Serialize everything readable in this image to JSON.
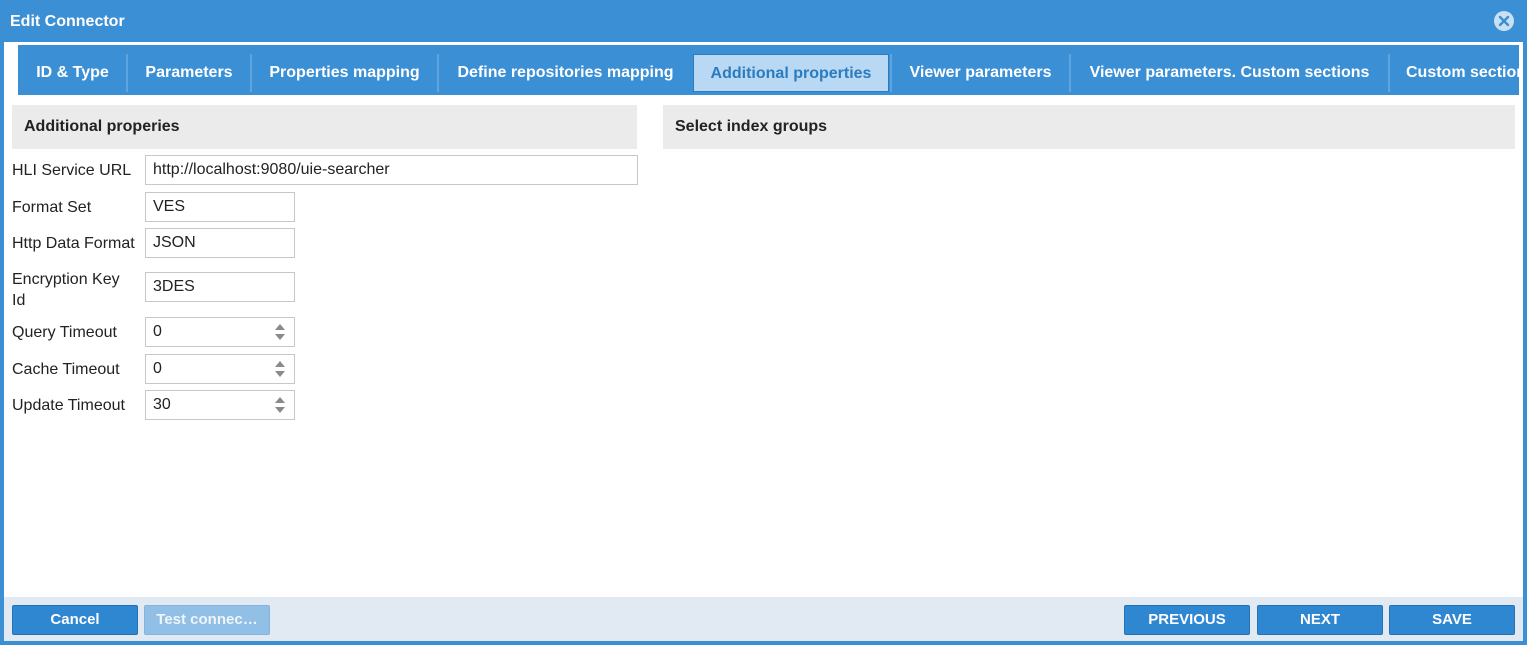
{
  "window": {
    "title": "Edit Connector",
    "close_icon": "close-circle-icon"
  },
  "tabs": [
    {
      "label": "ID & Type"
    },
    {
      "label": "Parameters"
    },
    {
      "label": "Properties mapping"
    },
    {
      "label": "Define repositories mapping"
    },
    {
      "label": "Additional properties",
      "active": true
    },
    {
      "label": "Viewer parameters"
    },
    {
      "label": "Viewer parameters. Custom sections"
    },
    {
      "label": "Custom sections"
    }
  ],
  "left_panel": {
    "header": "Additional properies",
    "fields": {
      "hli_service_url": {
        "label": "HLI Service URL",
        "value": "http://localhost:9080/uie-searcher"
      },
      "format_set": {
        "label": "Format Set",
        "value": "VES"
      },
      "http_data_format": {
        "label": "Http Data Format",
        "value": "JSON"
      },
      "encryption_key_id": {
        "label": "Encryption Key Id",
        "value": "3DES"
      },
      "query_timeout": {
        "label": "Query Timeout",
        "value": "0"
      },
      "cache_timeout": {
        "label": "Cache Timeout",
        "value": "0"
      },
      "update_timeout": {
        "label": "Update Timeout",
        "value": "30"
      }
    }
  },
  "right_panel": {
    "header": "Select index groups"
  },
  "footer": {
    "cancel": "Cancel",
    "test_connection": "Test connec…",
    "previous": "PREVIOUS",
    "next": "NEXT",
    "save": "SAVE"
  },
  "colors": {
    "accent": "#3b8fd4",
    "active_tab_bg": "#b8d8f3",
    "active_tab_text": "#2a7bbf",
    "panel_header_bg": "#ebebeb",
    "footer_bg": "#e1eaf3"
  }
}
